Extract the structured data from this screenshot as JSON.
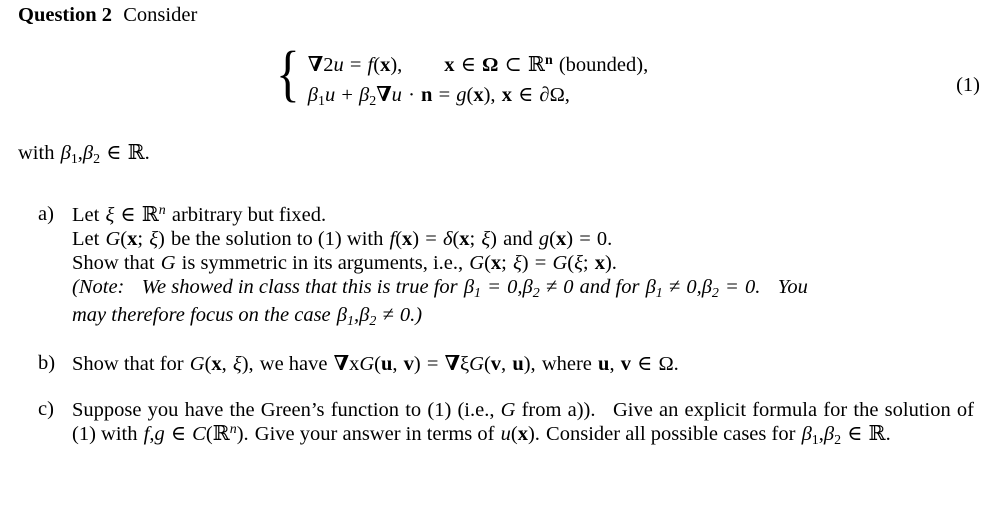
{
  "document": {
    "type": "math-homework-problem",
    "heading": {
      "label": "Question 2",
      "text": "Consider"
    },
    "equation": {
      "number": "(1)",
      "line1": "∇²u = f(x),    x ∈ Ω ⊂ ℝⁿ (bounded),",
      "line2": "β₁u + β₂∇u · n = g(x), x ∈ ∂Ω,",
      "line1_parts": {
        "nabla": "∇",
        "nabla_power": "2",
        "u": "u",
        "equals": "=",
        "f": "f",
        "x_bold": "x",
        "comma": ",",
        "in": "∈",
        "omega": "Ω",
        "subset": "⊂",
        "reals": "ℝ",
        "n_exponent": "n",
        "bounded": "(bounded),"
      },
      "line2_parts": {
        "beta": "β",
        "one": "1",
        "two": "2",
        "plus": "+",
        "nabla": "∇",
        "dot": "·",
        "n_bold": "n",
        "g": "g",
        "partial_omega": "∂Ω,"
      }
    },
    "with_line": {
      "prefix": "with",
      "beta": "β",
      "sub1": "1",
      "sub2": "2",
      "in": "∈",
      "reals": "ℝ",
      "period": "."
    },
    "items": [
      {
        "id": "a",
        "label": "a)",
        "lines": [
          "Let ξ ∈ ℝⁿ arbitrary but fixed.",
          "Let G(x; ξ) be the solution to (1) with f(x) = δ(x; ξ) and g(x) = 0.",
          "Show that G is symmetric in its arguments, i.e., G(x; ξ) = G(ξ; x).",
          "(Note: We showed in class that this is true for β₁ = 0, β₂ ≠ 0 and for β₁ ≠ 0, β₂ = 0. You may therefore focus on the case β₁, β₂ ≠ 0.)"
        ]
      },
      {
        "id": "b",
        "label": "b)",
        "lines": [
          "Show that for G(x, ξ), we have ∇ₓG(u, v) = ∇_ξG(v, u), where u, v ∈ Ω."
        ]
      },
      {
        "id": "c",
        "label": "c)",
        "lines": [
          "Suppose you have the Green's function to (1) (i.e., G from a)). Give an explicit formula for the solution of (1) with f, g ∈ C(ℝⁿ). Give your answer in terms of u(x). Consider all possible cases for β₁, β₂ ∈ ℝ."
        ]
      }
    ],
    "symbols": {
      "nabla": "∇",
      "delta": "δ",
      "xi": "ξ",
      "beta": "β",
      "omega_upper": "Ω",
      "partial": "∂",
      "element_of": "∈",
      "subset_of": "⊂",
      "not_equal": "≠",
      "blackboard_r": "ℝ",
      "cdot": "·"
    },
    "colors": {
      "text": "#000000",
      "background": "#ffffff"
    }
  }
}
